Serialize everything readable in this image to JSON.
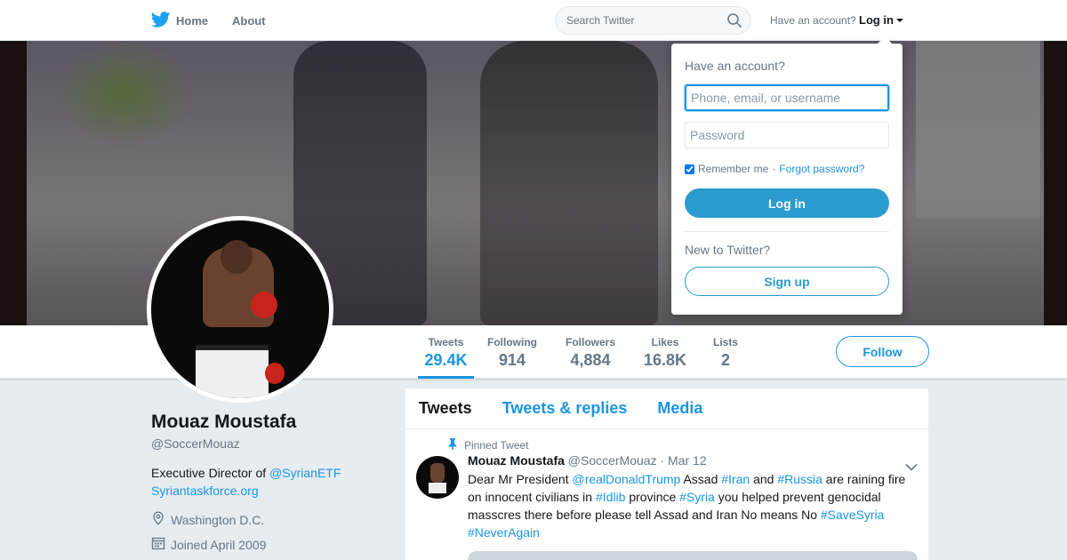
{
  "nav": {
    "home_label": "Home",
    "about_label": "About",
    "search_placeholder": "Search Twitter",
    "have_account_text": "Have an account?",
    "login_label": "Log in",
    "icons": [
      "twitter-bird-icon",
      "search-icon",
      "chevron-down-icon"
    ]
  },
  "stats": [
    {
      "label": "Tweets",
      "value": "29.4K"
    },
    {
      "label": "Following",
      "value": "914"
    },
    {
      "label": "Followers",
      "value": "4,884"
    },
    {
      "label": "Likes",
      "value": "16.8K"
    },
    {
      "label": "Lists",
      "value": "2"
    }
  ],
  "follow_label": "Follow",
  "profile": {
    "name": "Mouaz Moustafa",
    "handle": "@SoccerMouaz",
    "bio_prefix": "Executive Director of ",
    "bio_mention": "@SyrianETF",
    "bio_link": "Syriantaskforce.org",
    "location": "Washington D.C.",
    "joined": "Joined April 2009"
  },
  "timeline": {
    "tabs": [
      "Tweets",
      "Tweets & replies",
      "Media"
    ],
    "pinned_label": "Pinned Tweet",
    "tweet": {
      "name": "Mouaz Moustafa",
      "handle": "@SoccerMouaz",
      "sep": "·",
      "date": "Mar 12",
      "text_parts": [
        {
          "t": "Dear Mr President ",
          "link": false
        },
        {
          "t": "@realDonaldTrump",
          "link": true
        },
        {
          "t": " Assad ",
          "link": false
        },
        {
          "t": "#Iran",
          "link": true
        },
        {
          "t": " and ",
          "link": false
        },
        {
          "t": "#Russia",
          "link": true
        },
        {
          "t": " are raining fire on innocent civilians in ",
          "link": false
        },
        {
          "t": "#Idlib",
          "link": true
        },
        {
          "t": " province ",
          "link": false
        },
        {
          "t": "#Syria",
          "link": true
        },
        {
          "t": " you helped prevent genocidal masscres there before please tell Assad and Iran No means No ",
          "link": false
        },
        {
          "t": "#SaveSyria",
          "link": true
        },
        {
          "t": " ",
          "link": false
        },
        {
          "t": "#NeverAgain",
          "link": true
        }
      ]
    }
  },
  "login_dropdown": {
    "title": "Have an account?",
    "username_placeholder": "Phone, email, or username",
    "password_placeholder": "Password",
    "remember_label": "Remember me",
    "dot": "·",
    "forgot_label": "Forgot password?",
    "login_button": "Log in",
    "new_label": "New to Twitter?",
    "signup_button": "Sign up"
  },
  "colors": {
    "accent": "#1b95e0",
    "login_button": "#2b9bcf",
    "background": "#e6ecf0"
  }
}
